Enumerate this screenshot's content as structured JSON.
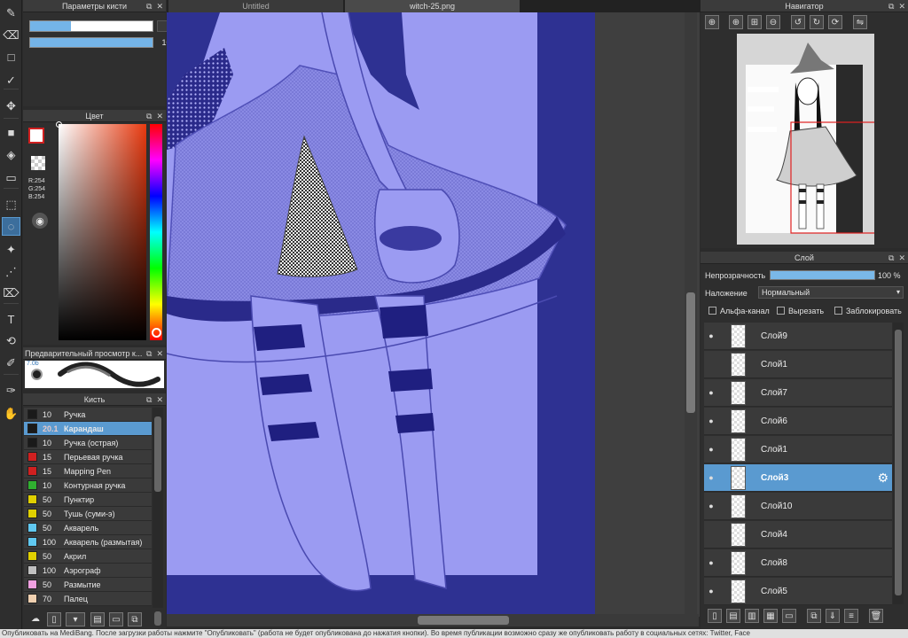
{
  "tools": [
    {
      "name": "brush-tool-icon",
      "glyph": "✎"
    },
    {
      "name": "eraser-tool-icon",
      "glyph": "⌫"
    },
    {
      "name": "rectangle-tool-icon",
      "glyph": "□"
    },
    {
      "name": "correction-tool-icon",
      "glyph": "✓"
    },
    {
      "name": "move-tool-icon",
      "glyph": "✥"
    },
    {
      "name": "fill-tool-icon",
      "glyph": "■"
    },
    {
      "name": "bucket-tool-icon",
      "glyph": "◈"
    },
    {
      "name": "gradient-tool-icon",
      "glyph": "▭"
    },
    {
      "name": "select-tool-icon",
      "glyph": "⬚"
    },
    {
      "name": "lasso-tool-icon",
      "glyph": "◌"
    },
    {
      "name": "magic-wand-tool-icon",
      "glyph": "✦"
    },
    {
      "name": "select-pen-tool-icon",
      "glyph": "⋰"
    },
    {
      "name": "select-eraser-tool-icon",
      "glyph": "⌦"
    },
    {
      "name": "text-tool-icon",
      "glyph": "T"
    },
    {
      "name": "split-tool-icon",
      "glyph": "⟲"
    },
    {
      "name": "blur-tool-icon",
      "glyph": "✐"
    },
    {
      "name": "eyedropper-tool-icon",
      "glyph": "✑"
    },
    {
      "name": "hand-tool-icon",
      "glyph": "✋"
    }
  ],
  "brush_params": {
    "title": "Параметры кисти",
    "size_value": "20",
    "opacity_value": "100 %",
    "size_fraction": 0.33,
    "opacity_fraction": 1.0
  },
  "color_panel": {
    "title": "Цвет",
    "r": "R:254",
    "g": "G:254",
    "b": "B:254"
  },
  "preview": {
    "title": "Предварительный просмотр к...",
    "size_text": "7.0b"
  },
  "brush_list": {
    "title": "Кисть",
    "items": [
      {
        "size": "10",
        "label": "Ручка",
        "color": "#1a1a1a"
      },
      {
        "size": "20.1",
        "label": "Карандаш",
        "color": "#1a1a1a"
      },
      {
        "size": "10",
        "label": "Ручка (острая)",
        "color": "#1a1a1a"
      },
      {
        "size": "15",
        "label": "Перьевая ручка",
        "color": "#d02020"
      },
      {
        "size": "15",
        "label": "Mapping Pen",
        "color": "#d02020"
      },
      {
        "size": "10",
        "label": "Контурная ручка",
        "color": "#30b030"
      },
      {
        "size": "50",
        "label": "Пунктир",
        "color": "#e0d000"
      },
      {
        "size": "50",
        "label": "Тушь (суми-э)",
        "color": "#e0d000"
      },
      {
        "size": "50",
        "label": "Акварель",
        "color": "#60c8f0"
      },
      {
        "size": "100",
        "label": "Акварель (размытая)",
        "color": "#60c8f0"
      },
      {
        "size": "50",
        "label": "Акрил",
        "color": "#e0d000"
      },
      {
        "size": "100",
        "label": "Аэрограф",
        "color": "#c0c0c0"
      },
      {
        "size": "50",
        "label": "Размытие",
        "color": "#f0a0e0"
      },
      {
        "size": "70",
        "label": "Палец",
        "color": "#f0d0b0"
      }
    ]
  },
  "tabs": [
    {
      "label": "Untitled"
    },
    {
      "label": "witch-25.png"
    }
  ],
  "navigator": {
    "title": "Навигатор"
  },
  "layers": {
    "title": "Слой",
    "opacity_label": "Непрозрачность",
    "opacity_value": "100 %",
    "opacity_fraction": 1.0,
    "blend_label": "Наложение",
    "blend_value": "Нормальный",
    "alpha_label": "Альфа-канал",
    "clip_label": "Вырезать",
    "lock_label": "Заблокировать",
    "items": [
      {
        "name": "Слой9",
        "visible": true
      },
      {
        "name": "Слой1",
        "visible": false
      },
      {
        "name": "Слой7",
        "visible": true
      },
      {
        "name": "Слой6",
        "visible": true
      },
      {
        "name": "Слой1",
        "visible": true
      },
      {
        "name": "Слой3",
        "visible": true
      },
      {
        "name": "Слой10",
        "visible": true
      },
      {
        "name": "Слой4",
        "visible": false
      },
      {
        "name": "Слой8",
        "visible": true
      },
      {
        "name": "Слой5",
        "visible": true
      }
    ]
  },
  "status_bar": {
    "text": "Опубликовать на MediBang. После загрузки работы нажмите \"Опубликовать\" (работа не будет опубликована до нажатия кнопки). Во время публикации возможно сразу же опубликовать работу в социальных сетях: Twitter, Face"
  },
  "colors": {
    "accent": "#5a9ad0",
    "canvas_bg": "#9b9bf2",
    "canvas_dark": "#2a2a8a",
    "canvas_navy": "#2e3192"
  }
}
